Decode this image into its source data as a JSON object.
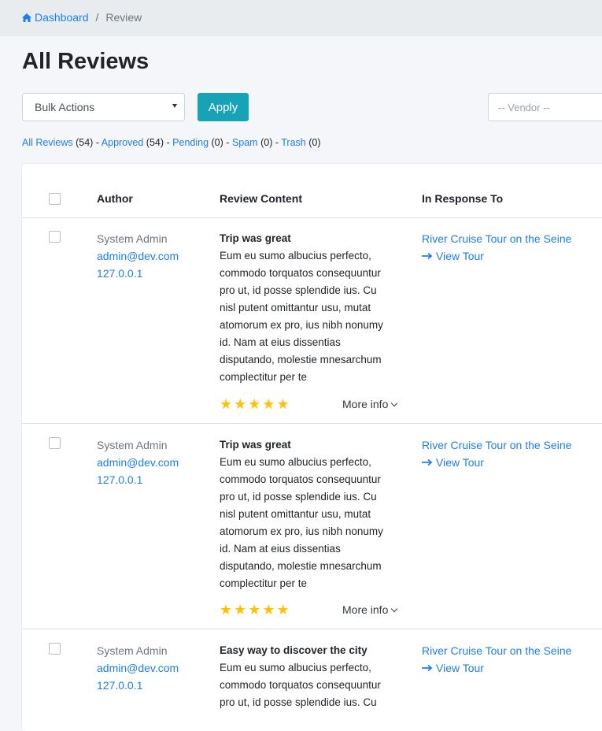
{
  "breadcrumb": {
    "home": "Dashboard",
    "separator": "/",
    "current": "Review"
  },
  "page_title": "All Reviews",
  "toolbar": {
    "bulk_actions": "Bulk Actions",
    "apply": "Apply",
    "vendor_placeholder": "-- Vendor --"
  },
  "filters": {
    "all": "All Reviews",
    "all_count": "(54)",
    "approved": "Approved",
    "approved_count": "(54)",
    "pending": "Pending",
    "pending_count": "(0)",
    "spam": "Spam",
    "spam_count": "(0)",
    "trash": "Trash",
    "trash_count": "(0)",
    "dash": "-"
  },
  "table": {
    "headers": {
      "author": "Author",
      "content": "Review Content",
      "response": "In Response To"
    },
    "rows": [
      {
        "author_name": "System Admin",
        "author_email": "admin@dev.com",
        "author_ip": "127.0.0.1",
        "title": "Trip was great",
        "lines": [
          "Eum eu sumo albucius perfecto,",
          "commodo torquatos consequuntur",
          "pro ut, id posse splendide ius. Cu",
          "nisl putent omittantur usu, mutat",
          "atomorum ex pro, ius nibh nonumy",
          "id. Nam at eius dissentias",
          "disputando, molestie mnesarchum",
          "complectitur per te"
        ],
        "stars": "★★★★★",
        "rating": 5,
        "more_info": "More info",
        "tour": "River Cruise Tour on the Seine",
        "view_tour": "View Tour"
      },
      {
        "author_name": "System Admin",
        "author_email": "admin@dev.com",
        "author_ip": "127.0.0.1",
        "title": "Trip was great",
        "lines": [
          "Eum eu sumo albucius perfecto,",
          "commodo torquatos consequuntur",
          "pro ut, id posse splendide ius. Cu",
          "nisl putent omittantur usu, mutat",
          "atomorum ex pro, ius nibh nonumy",
          "id. Nam at eius dissentias",
          "disputando, molestie mnesarchum",
          "complectitur per te"
        ],
        "stars": "★★★★★",
        "rating": 5,
        "more_info": "More info",
        "tour": "River Cruise Tour on the Seine",
        "view_tour": "View Tour"
      },
      {
        "author_name": "System Admin",
        "author_email": "admin@dev.com",
        "author_ip": "127.0.0.1",
        "title": "Easy way to discover the city",
        "lines": [
          "Eum eu sumo albucius perfecto,",
          "commodo torquatos consequuntur",
          "pro ut, id posse splendide ius. Cu"
        ],
        "tour": "River Cruise Tour on the Seine",
        "view_tour": "View Tour"
      }
    ]
  },
  "colors": {
    "link": "#1e7ee8",
    "apply_button": "#17a2b8",
    "star": "#ffc107"
  }
}
